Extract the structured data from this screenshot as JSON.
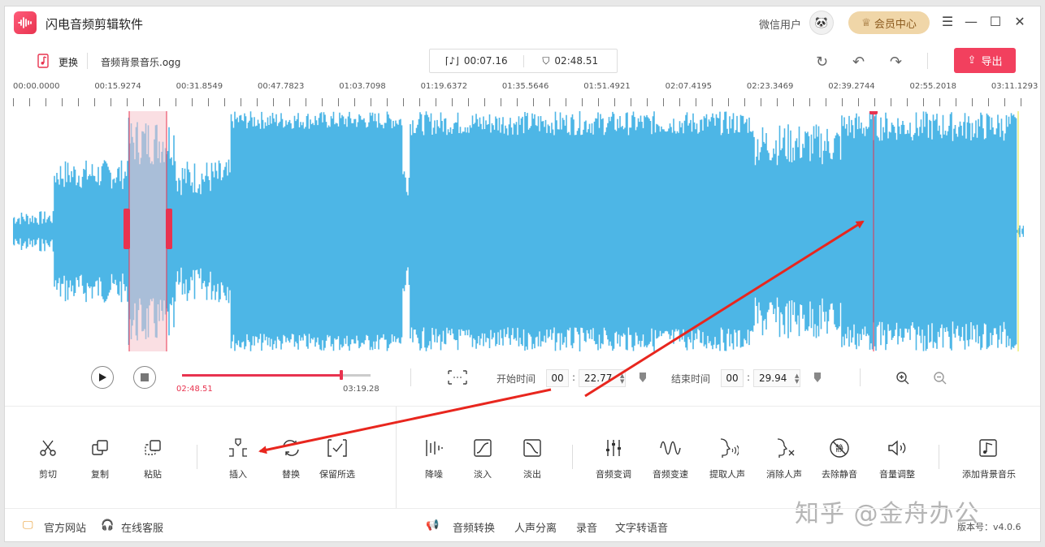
{
  "app": {
    "title": "闪电音频剪辑软件",
    "user": "微信用户",
    "vip": "会员中心"
  },
  "file": {
    "replace": "更换",
    "name": "音频背景音乐.ogg",
    "selection_length": "00:07.16",
    "total_length": "02:48.51",
    "export": "导出"
  },
  "ruler": {
    "labels": [
      "00:00.0000",
      "00:15.9274",
      "00:31.8549",
      "00:47.7823",
      "01:03.7098",
      "01:19.6372",
      "01:35.5646",
      "01:51.4921",
      "02:07.4195",
      "02:23.3469",
      "02:39.2744",
      "02:55.2018",
      "03:11.1293"
    ]
  },
  "playback": {
    "current": "02:48.51",
    "total": "03:19.28",
    "progress": 0.846
  },
  "range": {
    "start_label": "开始时间",
    "start_min": "00",
    "start_sec": "22.77",
    "end_label": "结束时间",
    "end_min": "00",
    "end_sec": "29.94",
    "colon": ":"
  },
  "tools_left": [
    {
      "label": "剪切",
      "icon": "scissors-icon"
    },
    {
      "label": "复制",
      "icon": "copy-icon"
    },
    {
      "label": "粘贴",
      "icon": "paste-icon"
    },
    {
      "label": "插入",
      "icon": "insert-icon"
    },
    {
      "label": "替换",
      "icon": "replace-icon"
    },
    {
      "label": "保留所选",
      "icon": "keep-selection-icon"
    }
  ],
  "tools_right": [
    {
      "label": "降噪",
      "icon": "denoise-icon"
    },
    {
      "label": "淡入",
      "icon": "fade-in-icon"
    },
    {
      "label": "淡出",
      "icon": "fade-out-icon"
    },
    {
      "label": "音频变调",
      "icon": "pitch-icon"
    },
    {
      "label": "音频变速",
      "icon": "speed-icon"
    },
    {
      "label": "提取人声",
      "icon": "extract-voice-icon"
    },
    {
      "label": "消除人声",
      "icon": "remove-voice-icon"
    },
    {
      "label": "去除静音",
      "icon": "remove-silence-icon"
    },
    {
      "label": "音量调整",
      "icon": "volume-icon"
    },
    {
      "label": "添加背景音乐",
      "icon": "bg-music-icon"
    }
  ],
  "footer": {
    "website": "官方网站",
    "service": "在线客服",
    "links": [
      "音频转换",
      "人声分离",
      "录音",
      "文字转语音"
    ],
    "version": "版本号：v4.0.6"
  },
  "watermark": "知乎 @金舟办公",
  "colors": {
    "accent": "#e8334f",
    "wave": "#4db6e6",
    "selection": "#f6c4cc"
  }
}
